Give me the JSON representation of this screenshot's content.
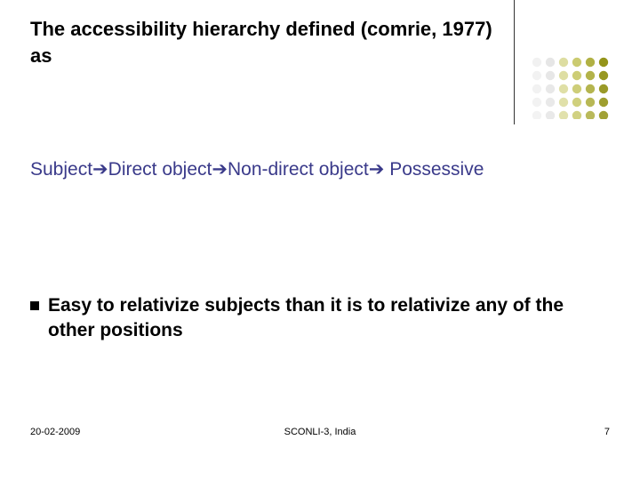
{
  "title": "The accessibility hierarchy defined (comrie, 1977) as",
  "hierarchy": {
    "items": [
      "Subject",
      "Direct object",
      "Non-direct object",
      "Possessive"
    ],
    "arrow": "➔"
  },
  "bullet": "Easy to relativize subjects than it is to relativize any of the other positions",
  "footer": {
    "date": "20-02-2009",
    "venue": "SCONLI-3, India",
    "page": "7"
  },
  "decor": {
    "dot_colors": [
      "#e6e6e6",
      "#d8d8d8",
      "#cfcf7a",
      "#bdbd4a",
      "#a5a528",
      "#8e8e0e"
    ]
  }
}
